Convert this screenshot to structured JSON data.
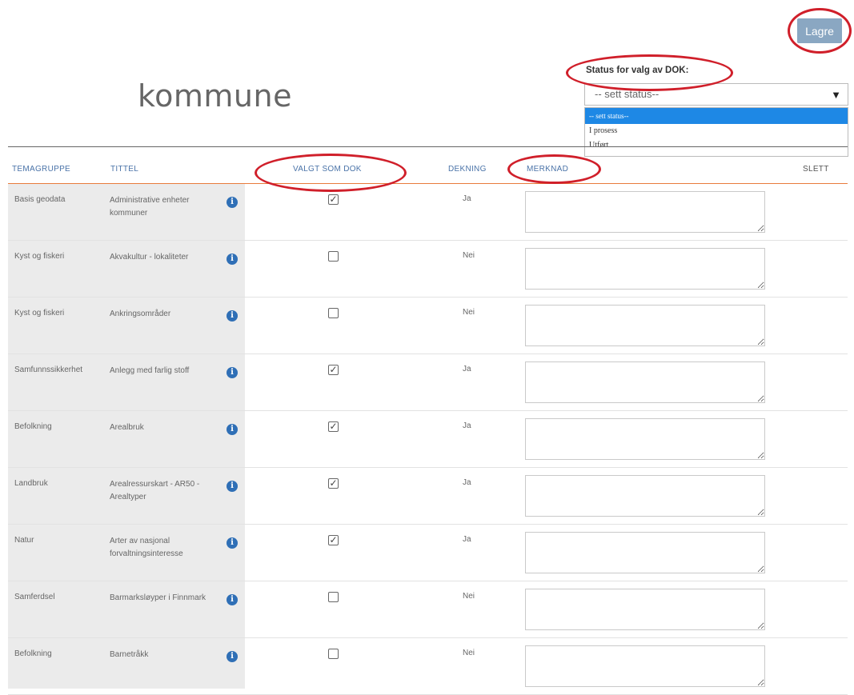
{
  "toolbar": {
    "save_label": "Lagre"
  },
  "page": {
    "title": "kommune"
  },
  "status": {
    "label": "Status for valg av DOK:",
    "selected": "-- sett status--",
    "options": [
      "-- sett status--",
      "I prosess",
      "Utført"
    ]
  },
  "table": {
    "headers": {
      "temagruppe": "TEMAGRUPPE",
      "tittel": "TITTEL",
      "valgt": "VALGT SOM DOK",
      "dekning": "DEKNING",
      "merknad": "MERKNAD",
      "slett": "SLETT"
    },
    "rows": [
      {
        "temagruppe": "Basis geodata",
        "tittel": "Administrative enheter kommuner",
        "valgt": true,
        "dekning": "Ja"
      },
      {
        "temagruppe": "Kyst og fiskeri",
        "tittel": "Akvakultur - lokaliteter",
        "valgt": false,
        "dekning": "Nei"
      },
      {
        "temagruppe": "Kyst og fiskeri",
        "tittel": "Ankringsområder",
        "valgt": false,
        "dekning": "Nei"
      },
      {
        "temagruppe": "Samfunnssikkerhet",
        "tittel": "Anlegg med farlig stoff",
        "valgt": true,
        "dekning": "Ja"
      },
      {
        "temagruppe": "Befolkning",
        "tittel": "Arealbruk",
        "valgt": true,
        "dekning": "Ja"
      },
      {
        "temagruppe": "Landbruk",
        "tittel": "Arealressurskart - AR50 - Arealtyper",
        "valgt": true,
        "dekning": "Ja"
      },
      {
        "temagruppe": "Natur",
        "tittel": "Arter av nasjonal forvaltningsinteresse",
        "valgt": true,
        "dekning": "Ja"
      },
      {
        "temagruppe": "Samferdsel",
        "tittel": "Barmarksløyper i Finnmark",
        "valgt": false,
        "dekning": "Nei"
      },
      {
        "temagruppe": "Befolkning",
        "tittel": "Barnetråkk",
        "valgt": false,
        "dekning": "Nei"
      }
    ]
  },
  "icons": {
    "info": "info-icon",
    "checkbox_checked": "☑",
    "checked_mark": "✓"
  },
  "colors": {
    "accent": "#8aa7c2",
    "header_text": "#4a73a8",
    "header_rule": "#e87b3c",
    "info_icon": "#2f6fb6",
    "annotation_ring": "#d01f2a",
    "dropdown_highlight": "#1e88e5"
  }
}
